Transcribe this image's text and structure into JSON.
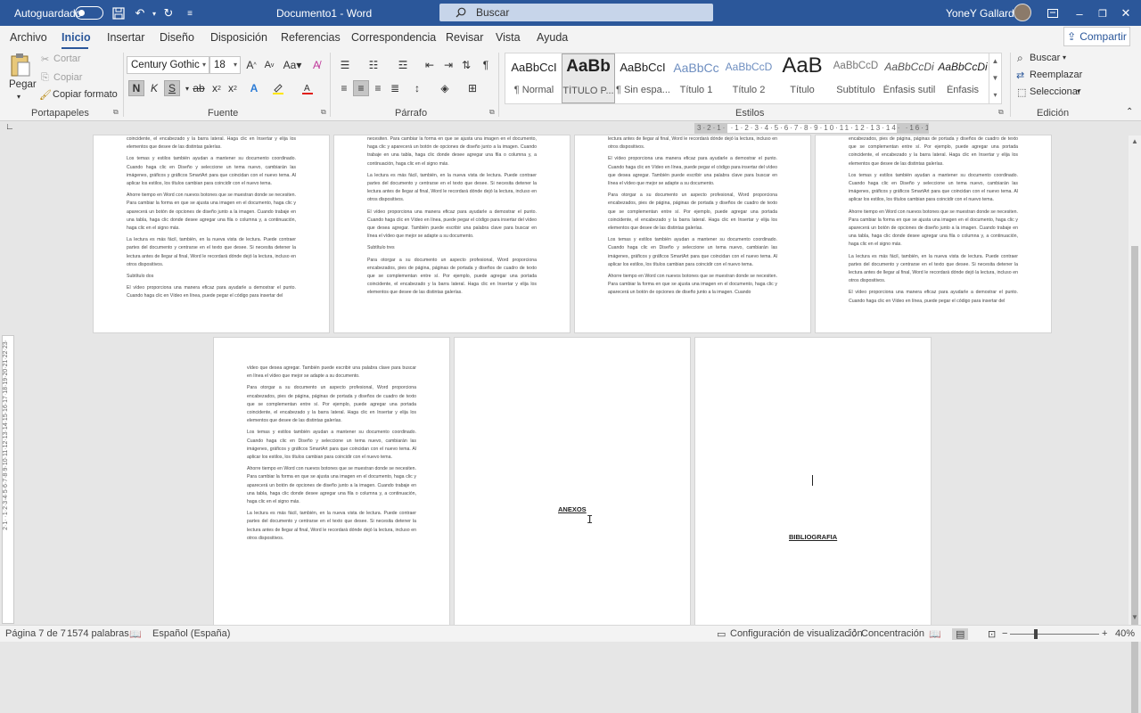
{
  "titlebar": {
    "autosave_label": "Autoguardado",
    "document_title": "Documento1 - Word",
    "search_placeholder": "Buscar",
    "user_name": "YoneY Gallardo"
  },
  "tabs": [
    "Archivo",
    "Inicio",
    "Insertar",
    "Diseño",
    "Disposición",
    "Referencias",
    "Correspondencia",
    "Revisar",
    "Vista",
    "Ayuda"
  ],
  "share_label": "Compartir",
  "ribbon": {
    "clipboard": {
      "paste": "Pegar",
      "cut": "Cortar",
      "copy": "Copiar",
      "format_painter": "Copiar formato",
      "label": "Portapapeles"
    },
    "font": {
      "name": "Century Gothic",
      "size": "18",
      "label": "Fuente"
    },
    "paragraph": {
      "label": "Párrafo"
    },
    "styles": {
      "label": "Estilos",
      "items": [
        {
          "preview": "AaBbCcI",
          "name": "¶ Normal"
        },
        {
          "preview": "AaBb",
          "name": "TÍTULO P..."
        },
        {
          "preview": "AaBbCcI",
          "name": "¶ Sin espa..."
        },
        {
          "preview": "AaBbCc",
          "name": "Título 1"
        },
        {
          "preview": "AaBbCcD",
          "name": "Título 2"
        },
        {
          "preview": "AaB",
          "name": "Título"
        },
        {
          "preview": "AaBbCcD",
          "name": "Subtítulo"
        },
        {
          "preview": "AaBbCcDi",
          "name": "Énfasis sutil"
        },
        {
          "preview": "AaBbCcDi",
          "name": "Énfasis"
        }
      ]
    },
    "editing": {
      "find": "Buscar",
      "replace": "Reemplazar",
      "select": "Seleccionar",
      "label": "Edición"
    }
  },
  "ruler": {
    "horizontal": "3·2·1· ·1·2·3·4·5·6·7·8·9·10·11·12·13·14· ·16·17·",
    "vertical": "2·1· ·1·2·3·4·5·6·7·8·9·10·11·12·13·14·15·16·17·18·19·20·21·22·23·"
  },
  "pages": {
    "p1": [
      "coincidente, el encabezado y la barra lateral. Haga clic en Insertar y elija los elementos que desee de las distintas galerías.",
      "Los temas y estilos también ayudan a mantener su documento coordinado. Cuando haga clic en Diseño y seleccione un tema nuevo, cambiarán las imágenes, gráficos y gráficos SmartArt para que coincidan con el nuevo tema. Al aplicar los estilos, los títulos cambian para coincidir con el nuevo tema.",
      "Ahorre tiempo en Word con nuevos botones que se muestran donde se necesiten. Para cambiar la forma en que se ajusta una imagen en el documento, haga clic y aparecerá un botón de opciones de diseño junto a la imagen. Cuando trabaje en una tabla, haga clic donde desee agregar una fila o columna y, a continuación, haga clic en el signo más.",
      "La lectura es más fácil, también, en la nueva vista de lectura. Puede contraer partes del documento y centrarse en el texto que desee. Si necesita detener la lectura antes de llegar al final, Word le recordará dónde dejó la lectura, incluso en otros dispositivos.",
      "Subtítulo dos",
      "El vídeo proporciona una manera eficaz para ayudarle a demostrar el punto. Cuando haga clic en Vídeo en línea, puede pegar el código para insertar del"
    ],
    "p2": [
      "necesiten. Para cambiar la forma en que se ajusta una imagen en el documento, haga clic y aparecerá un botón de opciones de diseño junto a la imagen. Cuando trabaje en una tabla, haga clic donde desee agregar una fila o columna y, a continuación, haga clic en el signo más.",
      "La lectura es más fácil, también, en la nueva vista de lectura. Puede contraer partes del documento y centrarse en el texto que desee. Si necesita detener la lectura antes de llegar al final, Word le recordará dónde dejó la lectura, incluso en otros dispositivos.",
      "El vídeo proporciona una manera eficaz para ayudarle a demostrar el punto. Cuando haga clic en Vídeo en línea, puede pegar el código para insertar del vídeo que desea agregar. También puede escribir una palabra clave para buscar en línea el vídeo que mejor se adapte a su documento.",
      "Subtítulo tres",
      "Para otorgar a su documento un aspecto profesional, Word proporciona encabezados, pies de página, páginas de portada y diseños de cuadro de texto que se complementan entre sí. Por ejemplo, puede agregar una portada coincidente, el encabezado y la barra lateral. Haga clic en Insertar y elija los elementos que desee de las distintas galerías."
    ],
    "p3": [
      "lectura antes de llegar al final, Word le recordará dónde dejó la lectura, incluso en otros dispositivos.",
      "El vídeo proporciona una manera eficaz para ayudarle a demostrar el punto. Cuando haga clic en Vídeo en línea, puede pegar el código para insertar del vídeo que desea agregar. También puede escribir una palabra clave para buscar en línea el vídeo que mejor se adapte a su documento.",
      "Para otorgar a su documento un aspecto profesional, Word proporciona encabezados, pies de página, páginas de portada y diseños de cuadro de texto que se complementan entre sí. Por ejemplo, puede agregar una portada coincidente, el encabezado y la barra lateral. Haga clic en Insertar y elija los elementos que desee de las distintas galerías.",
      "Los temas y estilos también ayudan a mantener su documento coordinado. Cuando haga clic en Diseño y seleccione un tema nuevo, cambiarán las imágenes, gráficos y gráficos SmartArt para que coincidan con el nuevo tema. Al aplicar los estilos, los títulos cambian para coincidir con el nuevo tema.",
      "Ahorre tiempo en Word con nuevos botones que se muestran donde se necesiten. Para cambiar la forma en que se ajusta una imagen en el documento, haga clic y aparecerá un botón de opciones de diseño junto a la imagen. Cuando"
    ],
    "p4": [
      "encabezados, pies de página, páginas de portada y diseños de cuadro de texto que se complementan entre sí. Por ejemplo, puede agregar una portada coincidente, el encabezado y la barra lateral. Haga clic en Insertar y elija los elementos que desee de las distintas galerías.",
      "Los temas y estilos también ayudan a mantener su documento coordinado. Cuando haga clic en Diseño y seleccione un tema nuevo, cambiarán las imágenes, gráficos y gráficos SmartArt para que coincidan con el nuevo tema. Al aplicar los estilos, los títulos cambian para coincidir con el nuevo tema.",
      "Ahorre tiempo en Word con nuevos botones que se muestran donde se necesiten. Para cambiar la forma en que se ajusta una imagen en el documento, haga clic y aparecerá un botón de opciones de diseño junto a la imagen. Cuando trabaje en una tabla, haga clic donde desee agregar una fila o columna y, a continuación, haga clic en el signo más.",
      "La lectura es más fácil, también, en la nueva vista de lectura. Puede contraer partes del documento y centrarse en el texto que desee. Si necesita detener la lectura antes de llegar al final, Word le recordará dónde dejó la lectura, incluso en otros dispositivos.",
      "El vídeo proporciona una manera eficaz para ayudarle a demostrar el punto. Cuando haga clic en Vídeo en línea, puede pegar el código para insertar del"
    ],
    "p5": [
      "vídeo que desea agregar. También puede escribir una palabra clave para buscar en línea el vídeo que mejor se adapte a su documento.",
      "Para otorgar a su documento un aspecto profesional, Word proporciona encabezados, pies de página, páginas de portada y diseños de cuadro de texto que se complementan entre sí. Por ejemplo, puede agregar una portada coincidente, el encabezado y la barra lateral. Haga clic en Insertar y elija los elementos que desee de las distintas galerías.",
      "Los temas y estilos también ayudan a mantener su documento coordinado. Cuando haga clic en Diseño y seleccione un tema nuevo, cambiarán las imágenes, gráficos y gráficos SmartArt para que coincidan con el nuevo tema. Al aplicar los estilos, los títulos cambian para coincidir con el nuevo tema.",
      "Ahorre tiempo en Word con nuevos botones que se muestran donde se necesiten. Para cambiar la forma en que se ajusta una imagen en el documento, haga clic y aparecerá un botón de opciones de diseño junto a la imagen. Cuando trabaje en una tabla, haga clic donde desee agregar una fila o columna y, a continuación, haga clic en el signo más.",
      "La lectura es más fácil, también, en la nueva vista de lectura. Puede contraer partes del documento y centrarse en el texto que desee. Si necesita detener la lectura antes de llegar al final, Word le recordará dónde dejó la lectura, incluso en otros dispositivos."
    ],
    "annex_heading": "ANEXOS",
    "bibliography_heading": "BIBLIOGRAFIA"
  },
  "statusbar": {
    "page": "Página 7 de 7",
    "words": "1574 palabras",
    "language": "Español (España)",
    "display_settings": "Configuración de visualización",
    "focus": "Concentración",
    "zoom": "40%"
  }
}
